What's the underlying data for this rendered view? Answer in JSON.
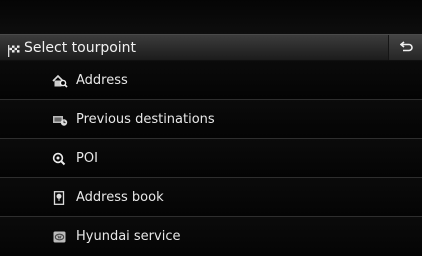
{
  "header": {
    "icon": "checkered-flag-icon",
    "title": "Select tourpoint",
    "back_icon": "back-arrow-icon"
  },
  "menu": {
    "items": [
      {
        "label": "Address",
        "icon": "address-house-search-icon"
      },
      {
        "label": "Previous destinations",
        "icon": "previous-destinations-icon"
      },
      {
        "label": "POI",
        "icon": "poi-search-icon"
      },
      {
        "label": "Address book",
        "icon": "address-book-icon"
      },
      {
        "label": "Hyundai service",
        "icon": "hyundai-service-icon"
      }
    ]
  },
  "colors": {
    "background": "#000000",
    "header_gradient_top": "#3c3c3c",
    "text": "#e8e8e8",
    "divider": "#2e2e2e"
  }
}
